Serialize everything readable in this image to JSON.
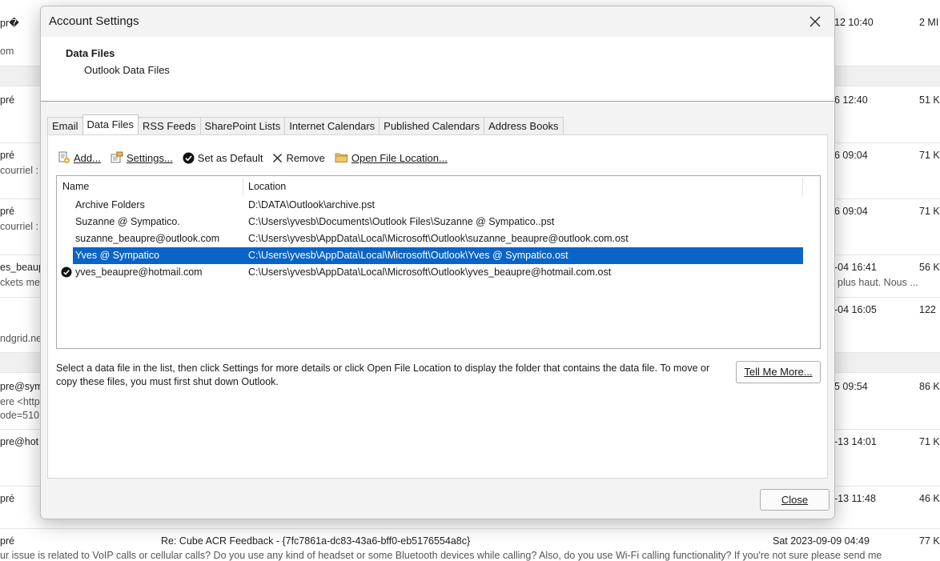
{
  "background": {
    "rows": [
      {
        "sender": "pr�",
        "time": "12 10:40",
        "size": "2 MI",
        "preview": "om"
      },
      {
        "sender": "pré",
        "time": "6 12:40",
        "size": "51 K",
        "preview": ""
      },
      {
        "sender": "pré",
        "time": "6 09:04",
        "size": "71 K",
        "preview": "courriel :"
      },
      {
        "sender": "pré",
        "time": "6 09:04",
        "size": "71 K",
        "preview": "courriel :"
      },
      {
        "sender": "es_beaup",
        "time": "-04 16:41",
        "size": "56 K",
        "preview": "ckets mer",
        "preview_right": "plus haut.  Nous ..."
      },
      {
        "sender": "",
        "time": "-04 16:05",
        "size": "122",
        "preview": "ndgrid.ne",
        "preview_right": "."
      },
      {
        "sender": "pre@sym",
        "time": "5 09:54",
        "size": "86 K",
        "preview": "ere <http",
        "preview2": "ode=510."
      },
      {
        "sender": "pre@hot",
        "time": "-13 14:01",
        "size": "71 K",
        "preview": ""
      },
      {
        "sender": "pré",
        "time": "-13 11:48",
        "size": "46 K",
        "preview": ""
      },
      {
        "sender": "pré",
        "subject": "Re: Cube ACR Feedback - {7fc7861a-dc83-43a6-bff0-eb5176554a8c}",
        "time": "Sat 2023-09-09 04:49",
        "size": "77 K",
        "preview": "ur issue is related to VoIP calls or cellular calls?  Do you use any kind of headset or some Bluetooth devices while calling? Also, do you use Wi-Fi calling functionality?  If you're not sure please send me"
      }
    ]
  },
  "dialog": {
    "title": "Account Settings",
    "header_title": "Data Files",
    "header_subtitle": "Outlook Data Files",
    "tabs": [
      "Email",
      "Data Files",
      "RSS Feeds",
      "SharePoint Lists",
      "Internet Calendars",
      "Published Calendars",
      "Address Books"
    ],
    "active_tab": "Data Files",
    "toolbar": {
      "add": "Add...",
      "settings": "Settings...",
      "set_default": "Set as Default",
      "remove": "Remove",
      "open_location": "Open File Location..."
    },
    "list": {
      "col_name": "Name",
      "col_location": "Location",
      "rows": [
        {
          "name": "Archive Folders",
          "location": "D:\\DATA\\Outlook\\archive.pst",
          "default": false,
          "selected": false
        },
        {
          "name": "Suzanne @ Sympatico.",
          "location": "C:\\Users\\yvesb\\Documents\\Outlook Files\\Suzanne @ Sympatico..pst",
          "default": false,
          "selected": false
        },
        {
          "name": "suzanne_beaupre@outlook.com",
          "location": "C:\\Users\\yvesb\\AppData\\Local\\Microsoft\\Outlook\\suzanne_beaupre@outlook.com.ost",
          "default": false,
          "selected": false
        },
        {
          "name": "Yves @ Sympatico",
          "location": "C:\\Users\\yvesb\\AppData\\Local\\Microsoft\\Outlook\\Yves @ Sympatico.ost",
          "default": false,
          "selected": true
        },
        {
          "name": "yves_beaupre@hotmail.com",
          "location": "C:\\Users\\yvesb\\AppData\\Local\\Microsoft\\Outlook\\yves_beaupre@hotmail.com.ost",
          "default": true,
          "selected": false
        }
      ]
    },
    "description": "Select a data file in the list, then click Settings for more details or click Open File Location to display the folder that contains the data file. To move or copy these files, you must first shut down Outlook.",
    "tell_more": "Tell Me More...",
    "close": "Close",
    "colors": {
      "selection": "#0a64c8"
    }
  }
}
